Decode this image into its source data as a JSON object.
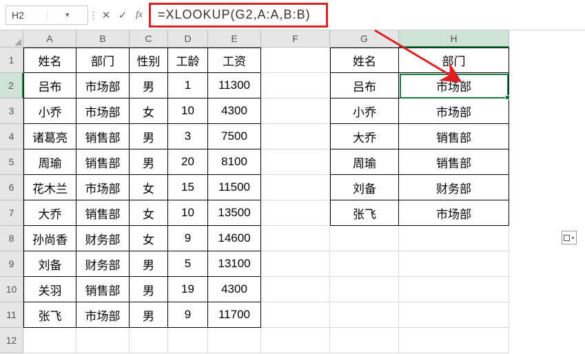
{
  "nameBox": "H2",
  "formula": "=XLOOKUP(G2,A:A,B:B)",
  "cols": [
    "A",
    "B",
    "C",
    "D",
    "E",
    "F",
    "G",
    "H"
  ],
  "rows": [
    "1",
    "2",
    "3",
    "4",
    "5",
    "6",
    "7",
    "8",
    "9",
    "10",
    "11",
    "12"
  ],
  "headersA": {
    "A": "姓名",
    "B": "部门",
    "C": "性别",
    "D": "工龄",
    "E": "工资"
  },
  "headersG": {
    "G": "姓名",
    "H": "部门"
  },
  "tableA": [
    {
      "A": "吕布",
      "B": "市场部",
      "C": "男",
      "D": "1",
      "E": "11300"
    },
    {
      "A": "小乔",
      "B": "市场部",
      "C": "女",
      "D": "10",
      "E": "4300"
    },
    {
      "A": "诸葛亮",
      "B": "销售部",
      "C": "男",
      "D": "3",
      "E": "7500"
    },
    {
      "A": "周瑜",
      "B": "销售部",
      "C": "男",
      "D": "20",
      "E": "8100"
    },
    {
      "A": "花木兰",
      "B": "市场部",
      "C": "女",
      "D": "15",
      "E": "11500"
    },
    {
      "A": "大乔",
      "B": "销售部",
      "C": "女",
      "D": "10",
      "E": "13500"
    },
    {
      "A": "孙尚香",
      "B": "财务部",
      "C": "女",
      "D": "9",
      "E": "14600"
    },
    {
      "A": "刘备",
      "B": "财务部",
      "C": "男",
      "D": "5",
      "E": "13100"
    },
    {
      "A": "关羽",
      "B": "销售部",
      "C": "男",
      "D": "19",
      "E": "4300"
    },
    {
      "A": "张飞",
      "B": "市场部",
      "C": "男",
      "D": "9",
      "E": "11700"
    }
  ],
  "tableG": [
    {
      "G": "吕布",
      "H": "市场部"
    },
    {
      "G": "小乔",
      "H": "市场部"
    },
    {
      "G": "大乔",
      "H": "销售部"
    },
    {
      "G": "周瑜",
      "H": "销售部"
    },
    {
      "G": "刘备",
      "H": "财务部"
    },
    {
      "G": "张飞",
      "H": "市场部"
    }
  ],
  "chart_data": null
}
